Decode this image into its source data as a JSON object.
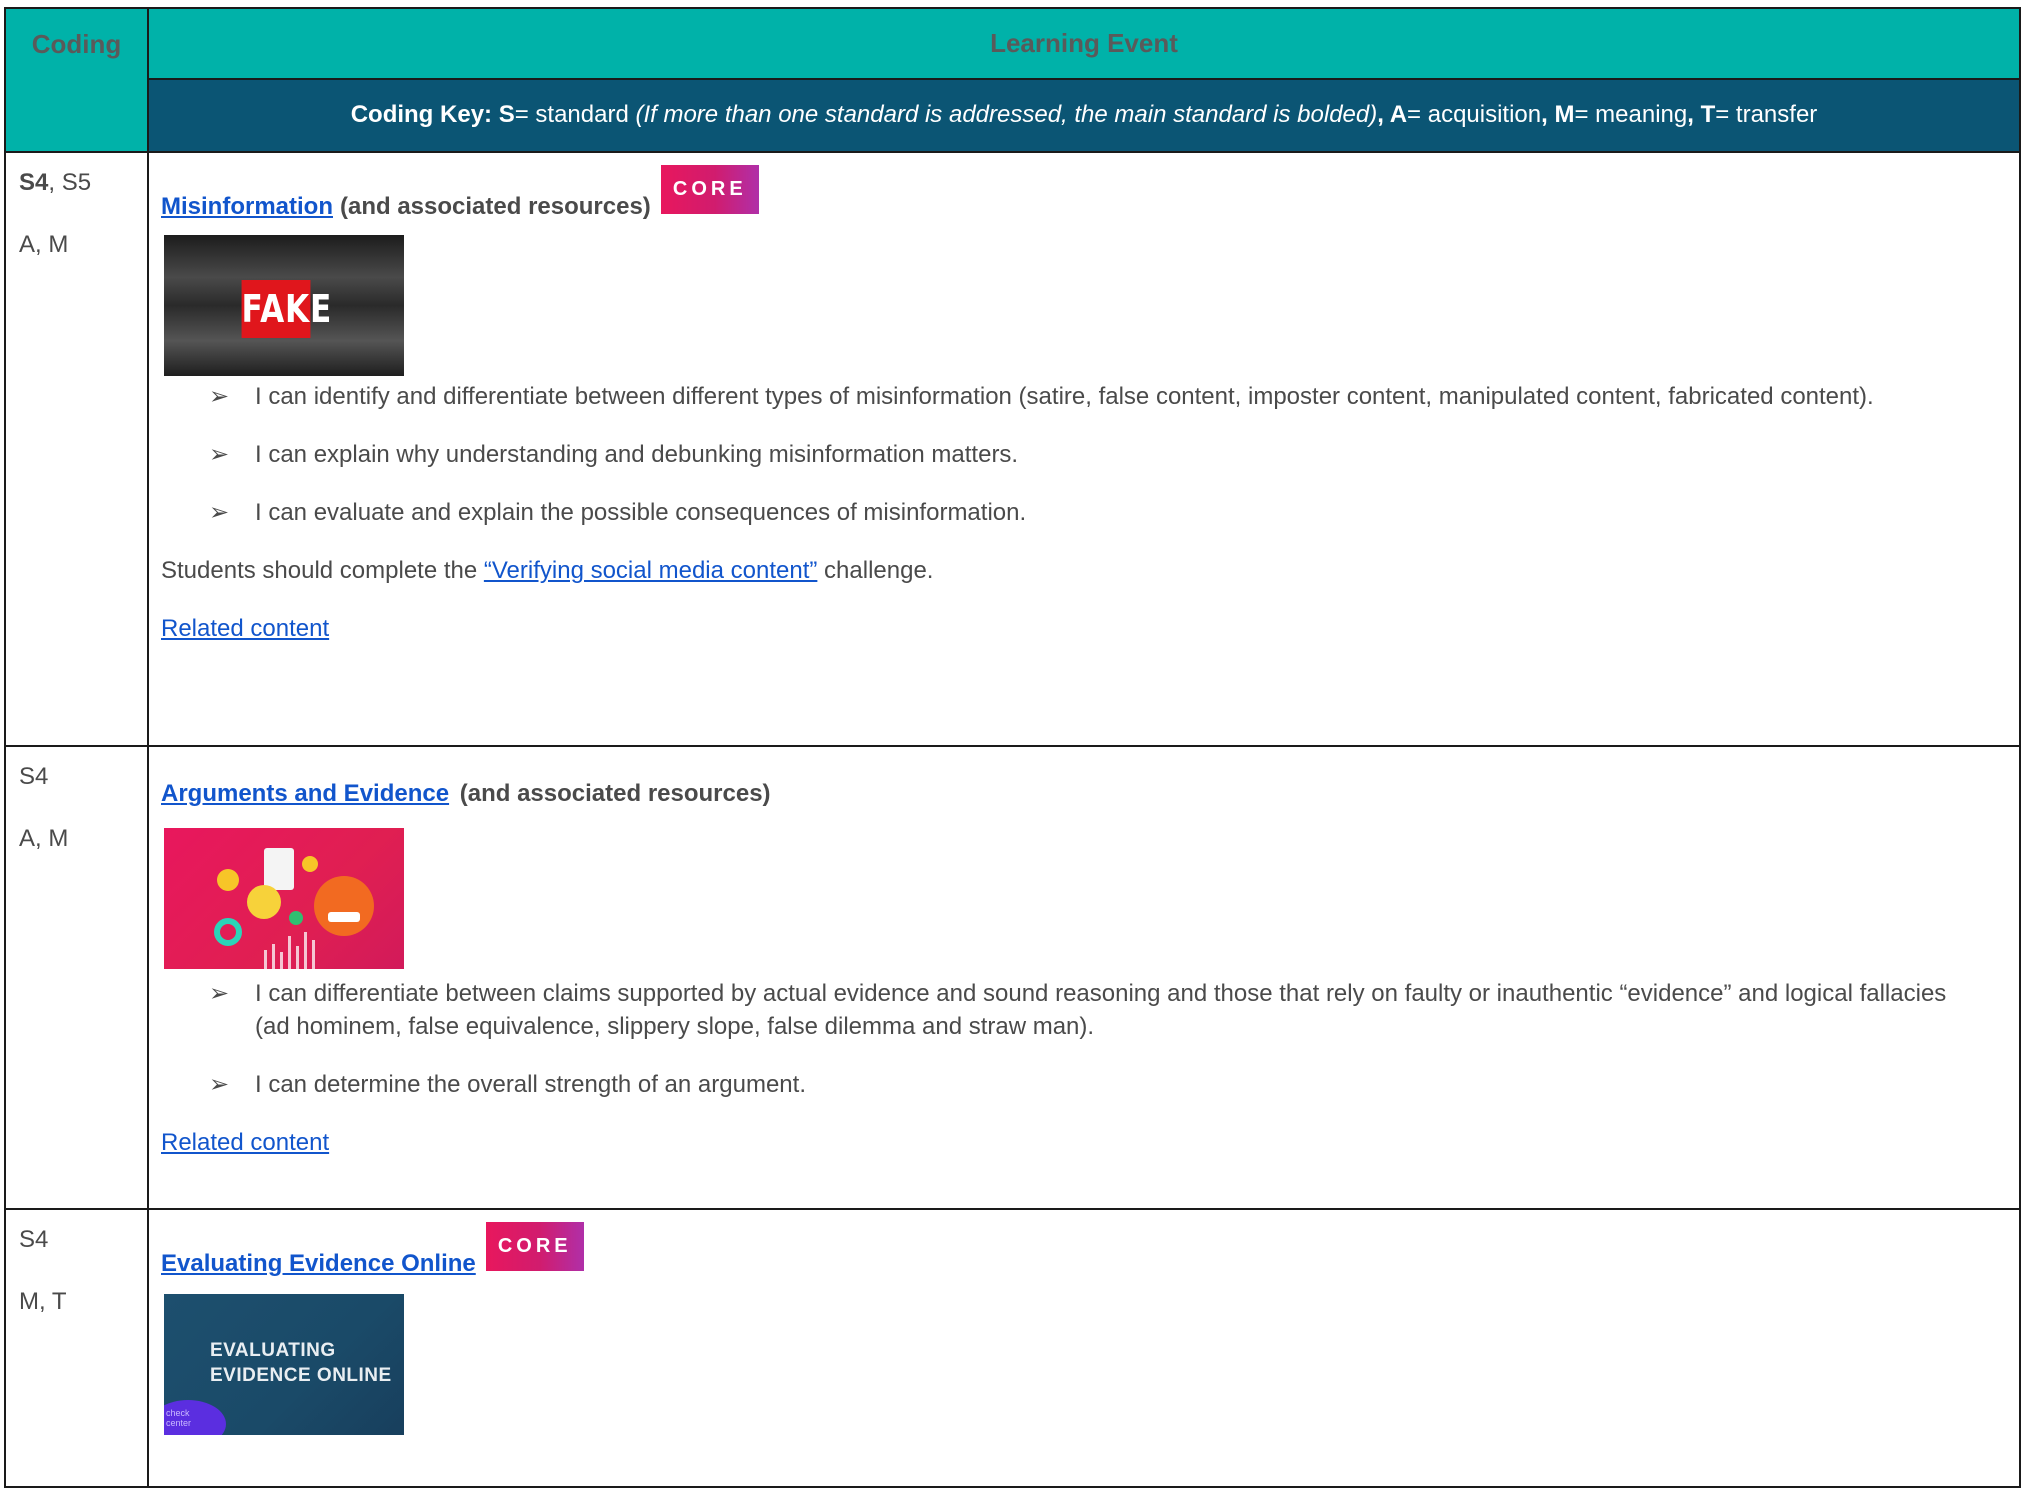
{
  "header": {
    "coding": "Coding",
    "learning_event": "Learning Event",
    "key_label": "Coding Key:",
    "key_s": "S",
    "key_s_def": "= standard ",
    "key_s_note": "(If more than one standard is addressed, the main standard is bolded)",
    "key_a": "A",
    "key_a_def": "= acquisition",
    "key_m": "M",
    "key_m_def": "= meaning",
    "key_t": "T",
    "key_t_def": "= transfer"
  },
  "arrow_glyph": "➢",
  "rows": [
    {
      "standards_main": "S4",
      "standards_rest": ", S5",
      "codes": "A, M",
      "title": "Misinformation",
      "title_suffix": "(and associated resources)",
      "badge": "CORE",
      "image_text": "FAKE",
      "bullets": [
        "I can identify and differentiate between different types of misinformation (satire, false content, imposter content, manipulated content, fabricated content).",
        "I can explain why understanding and debunking misinformation matters.",
        "I can evaluate and explain the possible consequences of misinformation."
      ],
      "note_before": "Students should complete the ",
      "note_link": "“Verifying social media content”",
      "note_after": " challenge.",
      "related": "Related content"
    },
    {
      "standards": "S4",
      "codes": "A, M",
      "title": "Arguments and Evidence",
      "title_suffix": "(and associated resources)",
      "bullets": [
        "I can differentiate between claims supported by actual evidence and sound reasoning and those that rely on faulty or inauthentic “evidence” and logical fallacies (ad hominem, false equivalence, slippery slope, false dilemma and straw man).",
        "I can determine the overall strength of an argument."
      ],
      "related": "Related content"
    },
    {
      "standards": "S4",
      "codes": "M, T",
      "title": "Evaluating Evidence Online",
      "badge": "CORE",
      "image_line1": "EVALUATING",
      "image_line2": "EVIDENCE ONLINE",
      "image_logo_line1": "check",
      "image_logo_line2": "center"
    }
  ]
}
